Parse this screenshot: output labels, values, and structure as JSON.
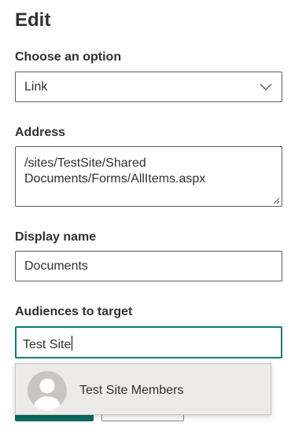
{
  "panel": {
    "title": "Edit"
  },
  "option": {
    "label": "Choose an option",
    "selected": "Link"
  },
  "address": {
    "label": "Address",
    "value": "/sites/TestSite/Shared\nDocuments/Forms/AllItems.aspx"
  },
  "display_name": {
    "label": "Display name",
    "value": "Documents"
  },
  "audiences": {
    "label": "Audiences to target",
    "value": "Test Site",
    "suggestions": [
      {
        "name": "Test Site Members",
        "icon": "person-avatar-icon"
      }
    ]
  },
  "colors": {
    "focus_border": "#0b7d74",
    "primary_button": "#0b6a62",
    "dropdown_bg": "#edebe9"
  }
}
